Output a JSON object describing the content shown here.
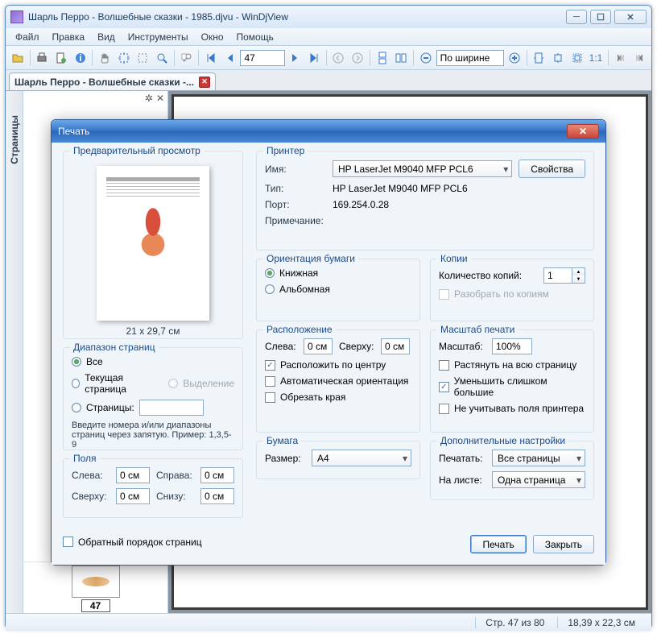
{
  "window": {
    "title": "Шарль Перро - Волшебные сказки - 1985.djvu - WinDjView",
    "app_name": "WinDjView"
  },
  "menu": {
    "file": "Файл",
    "edit": "Правка",
    "view": "Вид",
    "tools": "Инструменты",
    "window": "Окно",
    "help": "Помощь"
  },
  "toolbar": {
    "page_number": "47",
    "zoom_mode": "По ширине"
  },
  "tab": {
    "label": "Шарль Перро - Волшебные сказки -..."
  },
  "sidepanel": {
    "pages_label": "Страницы",
    "thumb_page": "47"
  },
  "statusbar": {
    "page": "Стр. 47 из 80",
    "size": "18,39 x 22,3 см"
  },
  "print": {
    "title": "Печать",
    "preview": {
      "label": "Предварительный просмотр",
      "page_size": "21 x 29,7 см"
    },
    "printer": {
      "label": "Принтер",
      "name_label": "Имя:",
      "name_value": "HP LaserJet M9040 MFP PCL6",
      "type_label": "Тип:",
      "type_value": "HP LaserJet M9040 MFP PCL6",
      "port_label": "Порт:",
      "port_value": "169.254.0.28",
      "comment_label": "Примечание:",
      "properties_btn": "Свойства"
    },
    "orientation": {
      "label": "Ориентация бумаги",
      "portrait": "Книжная",
      "landscape": "Альбомная"
    },
    "copies": {
      "label": "Копии",
      "count_label": "Количество копий:",
      "count_value": "1",
      "collate": "Разобрать по копиям"
    },
    "range": {
      "label": "Диапазон страниц",
      "all": "Все",
      "current": "Текущая страница",
      "selection": "Выделение",
      "pages": "Страницы:",
      "hint": "Введите номера и/или диапазоны страниц через запятую. Пример: 1,3,5-9"
    },
    "position": {
      "label": "Расположение",
      "left_label": "Слева:",
      "top_label": "Сверху:",
      "left_value": "0 см",
      "top_value": "0 см",
      "center": "Расположить по центру",
      "auto_orient": "Автоматическая ориентация",
      "crop": "Обрезать края"
    },
    "scale": {
      "label": "Масштаб печати",
      "scale_label": "Масштаб:",
      "scale_value": "100%",
      "fit": "Растянуть на всю страницу",
      "shrink": "Уменьшить слишком большие",
      "ignore_margins": "Не учитывать поля принтера"
    },
    "margins": {
      "label": "Поля",
      "left_label": "Слева:",
      "right_label": "Справа:",
      "top_label": "Сверху:",
      "bottom_label": "Снизу:",
      "left_value": "0 см",
      "right_value": "0 см",
      "top_value": "0 см",
      "bottom_value": "0 см"
    },
    "paper": {
      "label": "Бумага",
      "size_label": "Размер:",
      "size_value": "A4"
    },
    "extra": {
      "label": "Дополнительные настройки",
      "print_label": "Печатать:",
      "print_value": "Все страницы",
      "sheet_label": "На листе:",
      "sheet_value": "Одна страница"
    },
    "reverse": "Обратный порядок страниц",
    "buttons": {
      "print": "Печать",
      "close": "Закрыть"
    }
  }
}
